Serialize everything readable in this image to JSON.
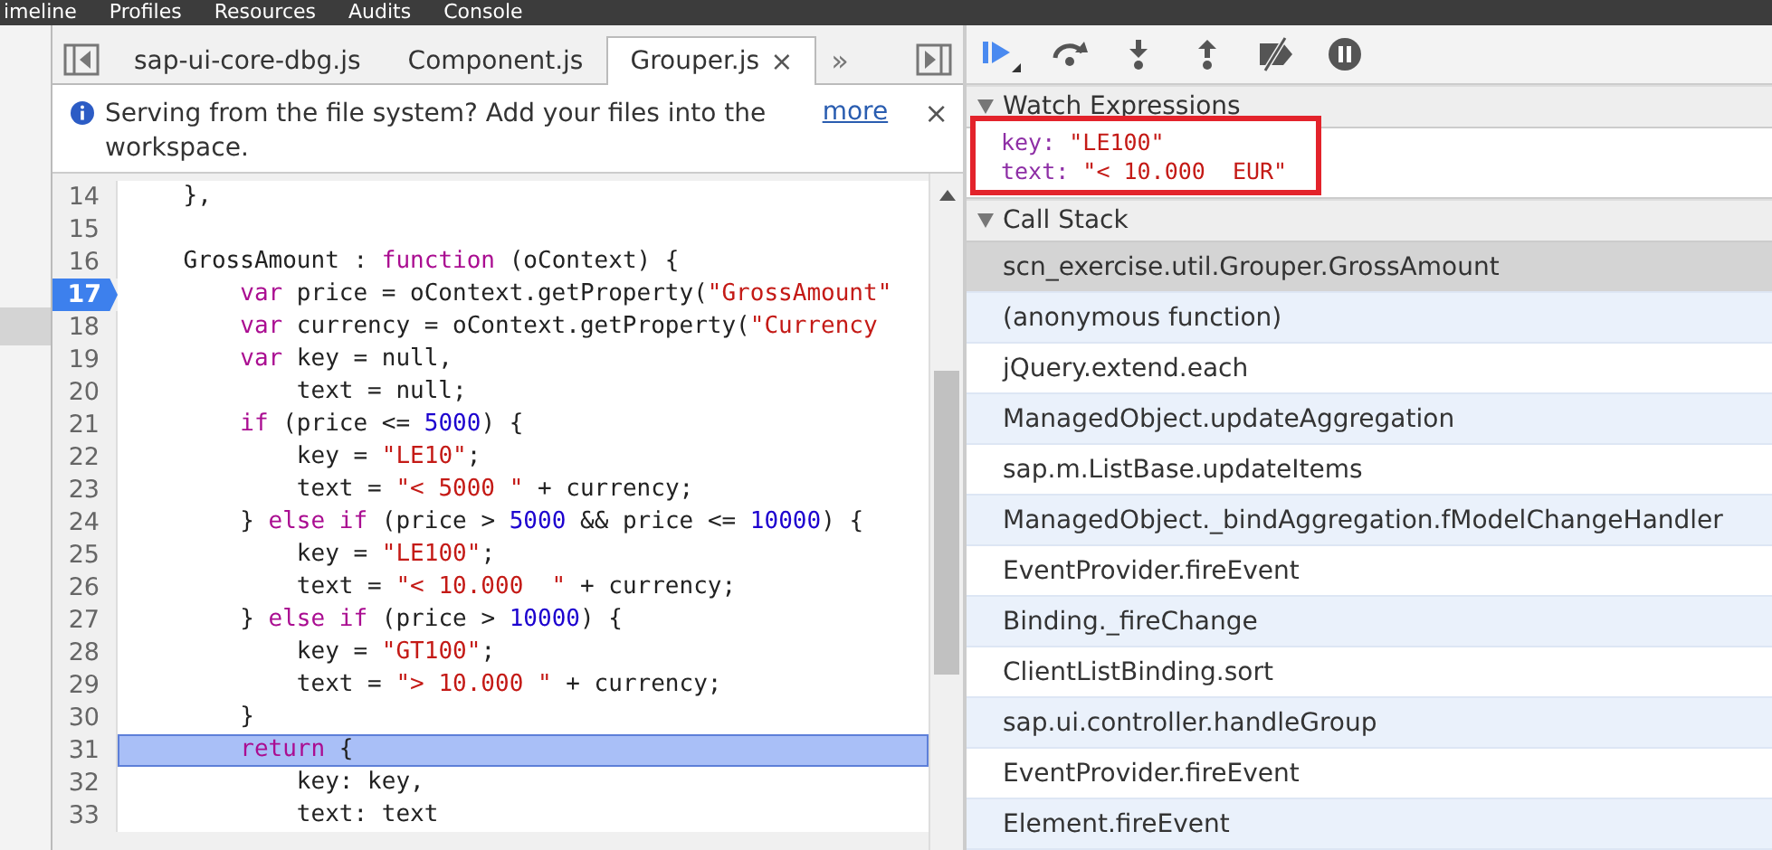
{
  "menu": [
    {
      "label": "imeline"
    },
    {
      "label": "Profiles"
    },
    {
      "label": "Resources"
    },
    {
      "label": "Audits"
    },
    {
      "label": "Console"
    }
  ],
  "tabs": [
    {
      "label": "sap-ui-core-dbg.js",
      "selected": false
    },
    {
      "label": "Component.js",
      "selected": false
    },
    {
      "label": "Grouper.js",
      "selected": true,
      "close": "×"
    }
  ],
  "tabs_overflow": "»",
  "infobar": {
    "message": "Serving from the file system? Add your files into the workspace.",
    "link": "more",
    "close": "×"
  },
  "code": [
    {
      "number": "14",
      "breakpoint": false,
      "current": false,
      "tokens": [
        {
          "kind": "plain",
          "t": "    },"
        }
      ]
    },
    {
      "number": "15",
      "breakpoint": false,
      "current": false
    },
    {
      "number": "16",
      "breakpoint": false,
      "current": false,
      "tokens": [
        {
          "kind": "plain",
          "t": "    GrossAmount : "
        },
        {
          "kind": "kw",
          "t": "function"
        },
        {
          "kind": "plain",
          "t": " (oContext) {"
        }
      ]
    },
    {
      "number": "17",
      "breakpoint": true,
      "current": false,
      "tokens": [
        {
          "kind": "kw",
          "t": "        var"
        },
        {
          "kind": "plain",
          "t": " price = oContext.getProperty("
        },
        {
          "kind": "str",
          "t": "\"GrossAmount\""
        }
      ]
    },
    {
      "number": "18",
      "breakpoint": false,
      "current": false,
      "tokens": [
        {
          "kind": "kw",
          "t": "        var"
        },
        {
          "kind": "plain",
          "t": " currency = oContext.getProperty("
        },
        {
          "kind": "str",
          "t": "\"Currency"
        }
      ]
    },
    {
      "number": "19",
      "breakpoint": false,
      "current": false,
      "tokens": [
        {
          "kind": "kw",
          "t": "        var"
        },
        {
          "kind": "plain",
          "t": " key = null,"
        }
      ]
    },
    {
      "number": "20",
      "breakpoint": false,
      "current": false,
      "tokens": [
        {
          "kind": "plain",
          "t": "            text = null;"
        }
      ]
    },
    {
      "number": "21",
      "breakpoint": false,
      "current": false,
      "tokens": [
        {
          "kind": "kw",
          "t": "        if"
        },
        {
          "kind": "plain",
          "t": " (price <= "
        },
        {
          "kind": "num",
          "t": "5000"
        },
        {
          "kind": "plain",
          "t": ") {"
        }
      ]
    },
    {
      "number": "22",
      "breakpoint": false,
      "current": false,
      "tokens": [
        {
          "kind": "plain",
          "t": "            key = "
        },
        {
          "kind": "str",
          "t": "\"LE10\""
        },
        {
          "kind": "plain",
          "t": ";"
        }
      ]
    },
    {
      "number": "23",
      "breakpoint": false,
      "current": false,
      "tokens": [
        {
          "kind": "plain",
          "t": "            text = "
        },
        {
          "kind": "str",
          "t": "\"< 5000 \""
        },
        {
          "kind": "plain",
          "t": " + currency;"
        }
      ]
    },
    {
      "number": "24",
      "breakpoint": false,
      "current": false,
      "tokens": [
        {
          "kind": "plain",
          "t": "        } "
        },
        {
          "kind": "kw",
          "t": "else if"
        },
        {
          "kind": "plain",
          "t": " (price > "
        },
        {
          "kind": "num",
          "t": "5000"
        },
        {
          "kind": "plain",
          "t": " && price <= "
        },
        {
          "kind": "num",
          "t": "10000"
        },
        {
          "kind": "plain",
          "t": ") {"
        }
      ]
    },
    {
      "number": "25",
      "breakpoint": false,
      "current": false,
      "tokens": [
        {
          "kind": "plain",
          "t": "            key = "
        },
        {
          "kind": "str",
          "t": "\"LE100\""
        },
        {
          "kind": "plain",
          "t": ";"
        }
      ]
    },
    {
      "number": "26",
      "breakpoint": false,
      "current": false,
      "tokens": [
        {
          "kind": "plain",
          "t": "            text = "
        },
        {
          "kind": "str",
          "t": "\"< 10.000  \""
        },
        {
          "kind": "plain",
          "t": " + currency;"
        }
      ]
    },
    {
      "number": "27",
      "breakpoint": false,
      "current": false,
      "tokens": [
        {
          "kind": "plain",
          "t": "        } "
        },
        {
          "kind": "kw",
          "t": "else if"
        },
        {
          "kind": "plain",
          "t": " (price > "
        },
        {
          "kind": "num",
          "t": "10000"
        },
        {
          "kind": "plain",
          "t": ") {"
        }
      ]
    },
    {
      "number": "28",
      "breakpoint": false,
      "current": false,
      "tokens": [
        {
          "kind": "plain",
          "t": "            key = "
        },
        {
          "kind": "str",
          "t": "\"GT100\""
        },
        {
          "kind": "plain",
          "t": ";"
        }
      ]
    },
    {
      "number": "29",
      "breakpoint": false,
      "current": false,
      "tokens": [
        {
          "kind": "plain",
          "t": "            text = "
        },
        {
          "kind": "str",
          "t": "\"> 10.000 \""
        },
        {
          "kind": "plain",
          "t": " + currency;"
        }
      ]
    },
    {
      "number": "30",
      "breakpoint": false,
      "current": false,
      "tokens": [
        {
          "kind": "plain",
          "t": "        }"
        }
      ]
    },
    {
      "number": "31",
      "breakpoint": false,
      "current": true,
      "tokens": [
        {
          "kind": "kw",
          "t": "        return"
        },
        {
          "kind": "plain",
          "t": " {"
        }
      ]
    },
    {
      "number": "32",
      "breakpoint": false,
      "current": false,
      "tokens": [
        {
          "kind": "plain",
          "t": "            key: key,"
        }
      ]
    },
    {
      "number": "33",
      "breakpoint": false,
      "current": false,
      "tokens": [
        {
          "kind": "plain",
          "t": "            text: text"
        }
      ]
    }
  ],
  "watch": {
    "title": "Watch Expressions",
    "expanded": true,
    "items": [
      {
        "name": "key:",
        "value": "\"LE100\""
      },
      {
        "name": "text:",
        "value": "\"< 10.000  EUR\""
      }
    ]
  },
  "call_stack": {
    "title": "Call Stack",
    "expanded": true,
    "frames": [
      {
        "label": "scn_exercise.util.Grouper.GrossAmount",
        "selected": true
      },
      {
        "label": "(anonymous function)",
        "selected": false
      },
      {
        "label": "jQuery.extend.each",
        "selected": false
      },
      {
        "label": "ManagedObject.updateAggregation",
        "selected": false
      },
      {
        "label": "sap.m.ListBase.updateItems",
        "selected": false
      },
      {
        "label": "ManagedObject._bindAggregation.fModelChangeHandler",
        "selected": false
      },
      {
        "label": "EventProvider.fireEvent",
        "selected": false
      },
      {
        "label": "Binding._fireChange",
        "selected": false
      },
      {
        "label": "ClientListBinding.sort",
        "selected": false
      },
      {
        "label": "sap.ui.controller.handleGroup",
        "selected": false
      },
      {
        "label": "EventProvider.fireEvent",
        "selected": false
      },
      {
        "label": "Element.fireEvent",
        "selected": false
      }
    ]
  }
}
